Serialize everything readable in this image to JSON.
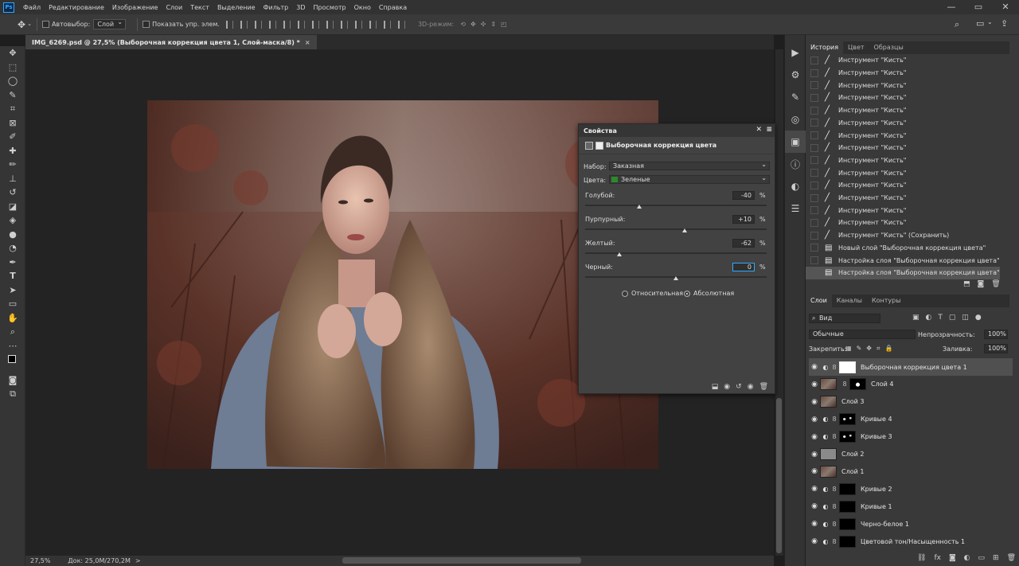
{
  "menubar": {
    "app_icon": "Ps",
    "items": [
      "Файл",
      "Редактирование",
      "Изображение",
      "Слои",
      "Текст",
      "Выделение",
      "Фильтр",
      "3D",
      "Просмотр",
      "Окно",
      "Справка"
    ],
    "window_controls": [
      "—",
      "▭",
      "✕"
    ]
  },
  "options_bar": {
    "autoselect_label": "Автовыбор:",
    "autoselect_value": "Слой",
    "show_transform_label": "Показать упр. элем.",
    "mode_3d_label": "3D-режим:"
  },
  "document_tab": {
    "title": "IMG_6269.psd @ 27,5% (Выборочная коррекция цвета 1, Слой-маска/8) *",
    "close": "×"
  },
  "status_bar": {
    "zoom": "27,5%",
    "doc_info": "Док: 25,0M/270,2M",
    "arrow": ">"
  },
  "properties_panel": {
    "title": "Свойства",
    "subtitle": "Выборочная коррекция цвета",
    "preset_label": "Набор:",
    "preset_value": "Заказная",
    "colors_label": "Цвета:",
    "colors_value": "Зеленые",
    "colors_swatch": "#2c8a2c",
    "sliders": [
      {
        "label": "Голубой:",
        "value": "-40",
        "unit": "%",
        "level": -40
      },
      {
        "label": "Пурпурный:",
        "value": "+10",
        "unit": "%",
        "level": 10
      },
      {
        "label": "Желтый:",
        "value": "-62",
        "unit": "%",
        "level": -62
      },
      {
        "label": "Черный:",
        "value": "0",
        "unit": "%",
        "level": 0
      }
    ],
    "method_relative": "Относительная",
    "method_absolute": "Абсолютная",
    "method_selected": "absolute"
  },
  "history_panel": {
    "tabs": [
      "История",
      "Цвет",
      "Образцы"
    ],
    "items": [
      "Инструмент \"Кисть\"",
      "Инструмент \"Кисть\"",
      "Инструмент \"Кисть\"",
      "Инструмент \"Кисть\"",
      "Инструмент \"Кисть\"",
      "Инструмент \"Кисть\"",
      "Инструмент \"Кисть\"",
      "Инструмент \"Кисть\"",
      "Инструмент \"Кисть\"",
      "Инструмент \"Кисть\"",
      "Инструмент \"Кисть\"",
      "Инструмент \"Кисть\"",
      "Инструмент \"Кисть\"",
      "Инструмент \"Кисть\"",
      "Инструмент \"Кисть\" (Сохранить)",
      "Новый слой \"Выборочная коррекция цвета\"",
      "Настройка слоя \"Выборочная коррекция цвета\"",
      "Настройка слоя \"Выборочная коррекция цвета\""
    ]
  },
  "layers_panel": {
    "tabs": [
      "Слои",
      "Каналы",
      "Контуры"
    ],
    "filter_label": "Вид",
    "blend_mode": "Обычные",
    "opacity_label": "Непрозрачность:",
    "opacity_value": "100%",
    "lock_label": "Закрепить:",
    "fill_label": "Заливка:",
    "fill_value": "100%",
    "layers": [
      {
        "name": "Выборочная коррекция цвета 1",
        "kind": "adjustment",
        "selected": true,
        "mask": "white"
      },
      {
        "name": "Слой 4",
        "kind": "pixel-mask",
        "mask": "black-white"
      },
      {
        "name": "Слой 3",
        "kind": "pixel"
      },
      {
        "name": "Кривые 4",
        "kind": "adjustment",
        "mask": "black-spots"
      },
      {
        "name": "Кривые 3",
        "kind": "adjustment",
        "mask": "black-spots"
      },
      {
        "name": "Слой 2",
        "kind": "gray"
      },
      {
        "name": "Слой 1",
        "kind": "pixel"
      },
      {
        "name": "Кривые 2",
        "kind": "adjustment",
        "mask": "black"
      },
      {
        "name": "Кривые 1",
        "kind": "adjustment",
        "mask": "black"
      },
      {
        "name": "Черно-белое 1",
        "kind": "adjustment",
        "mask": "black"
      },
      {
        "name": "Цветовой тон/Насыщенность 1",
        "kind": "adjustment",
        "mask": "black"
      }
    ]
  },
  "colors": {
    "accent": "#31a8ff",
    "panel": "#393939",
    "canvas": "#232323"
  }
}
